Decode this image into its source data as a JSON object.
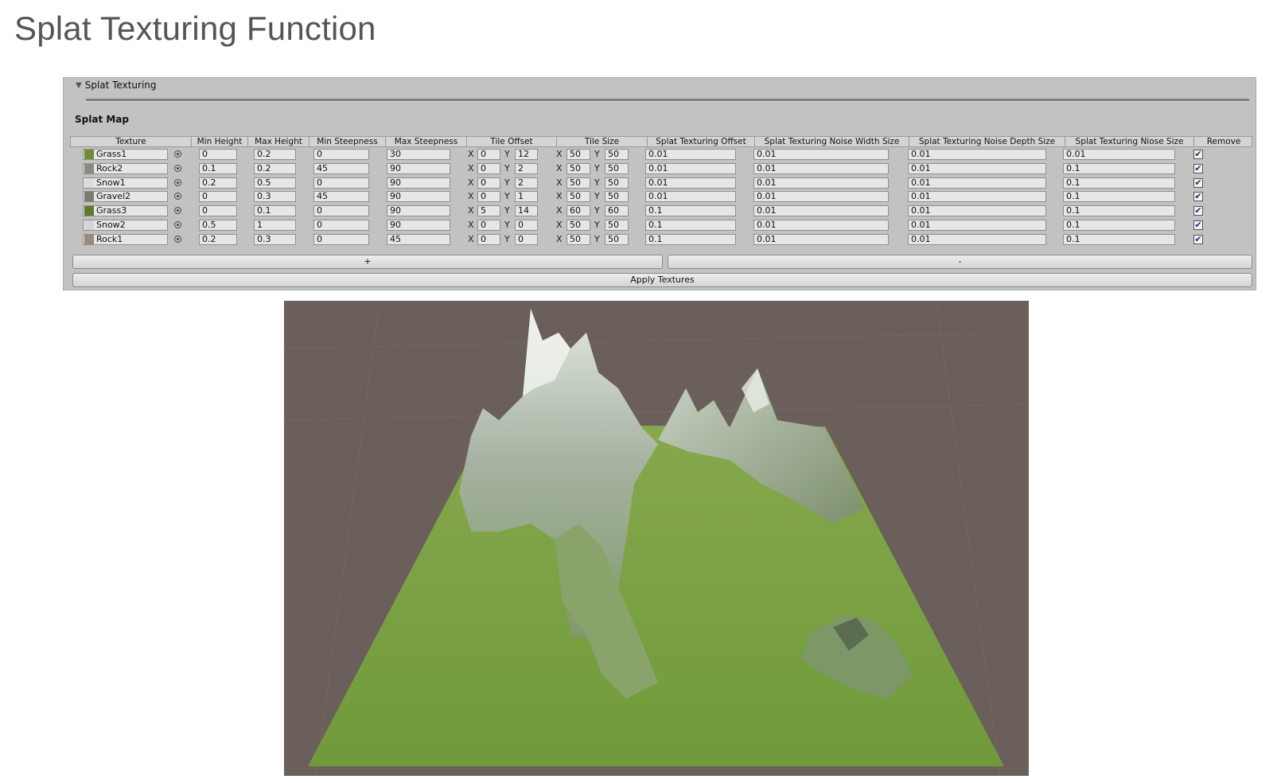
{
  "page_title": "Splat Texturing Function",
  "panel": {
    "foldout_label": "Splat Texturing",
    "section_label": "Splat Map",
    "columns": {
      "texture": "Texture",
      "min_height": "Min Height",
      "max_height": "Max Height",
      "min_steepness": "Min Steepness",
      "max_steepness": "Max Steepness",
      "tile_offset": "Tile Offset",
      "tile_size": "Tile Size",
      "splat_offset": "Splat Texturing Offset",
      "noise_width": "Splat Texturing Noise Width Size",
      "noise_depth": "Splat Texturing Noise Depth Size",
      "noise_size": "Splat Texturing Niose Size",
      "remove": "Remove"
    },
    "axis_labels": {
      "x": "X",
      "y": "Y"
    },
    "rows": [
      {
        "texture": "Grass1",
        "swatch": "#6f8b3a",
        "min_height": "0",
        "max_height": "0.2",
        "min_steepness": "0",
        "max_steepness": "30",
        "offset_x": "0",
        "offset_y": "12",
        "size_x": "50",
        "size_y": "50",
        "splat_offset": "0.01",
        "noise_width": "0.01",
        "noise_depth": "0.01",
        "noise_size": "0.01",
        "checked": "✔"
      },
      {
        "texture": "Rock2",
        "swatch": "#8a8a80",
        "min_height": "0.1",
        "max_height": "0.2",
        "min_steepness": "45",
        "max_steepness": "90",
        "offset_x": "0",
        "offset_y": "2",
        "size_x": "50",
        "size_y": "50",
        "splat_offset": "0.01",
        "noise_width": "0.01",
        "noise_depth": "0.01",
        "noise_size": "0.1",
        "checked": "✔"
      },
      {
        "texture": "Snow1",
        "swatch": "#dcdcdc",
        "min_height": "0.2",
        "max_height": "0.5",
        "min_steepness": "0",
        "max_steepness": "90",
        "offset_x": "0",
        "offset_y": "2",
        "size_x": "50",
        "size_y": "50",
        "splat_offset": "0.01",
        "noise_width": "0.01",
        "noise_depth": "0.01",
        "noise_size": "0.1",
        "checked": "✔"
      },
      {
        "texture": "Gravel2",
        "swatch": "#7c7c6c",
        "min_height": "0",
        "max_height": "0.3",
        "min_steepness": "45",
        "max_steepness": "90",
        "offset_x": "0",
        "offset_y": "1",
        "size_x": "50",
        "size_y": "50",
        "splat_offset": "0.01",
        "noise_width": "0.01",
        "noise_depth": "0.01",
        "noise_size": "0.1",
        "checked": "✔"
      },
      {
        "texture": "Grass3",
        "swatch": "#5f7a2c",
        "min_height": "0",
        "max_height": "0.1",
        "min_steepness": "0",
        "max_steepness": "90",
        "offset_x": "5",
        "offset_y": "14",
        "size_x": "60",
        "size_y": "60",
        "splat_offset": "0.1",
        "noise_width": "0.01",
        "noise_depth": "0.01",
        "noise_size": "0.1",
        "checked": "✔"
      },
      {
        "texture": "Snow2",
        "swatch": "#d6d6d6",
        "min_height": "0.5",
        "max_height": "1",
        "min_steepness": "0",
        "max_steepness": "90",
        "offset_x": "0",
        "offset_y": "0",
        "size_x": "50",
        "size_y": "50",
        "splat_offset": "0.1",
        "noise_width": "0.01",
        "noise_depth": "0.01",
        "noise_size": "0.1",
        "checked": "✔"
      },
      {
        "texture": "Rock1",
        "swatch": "#9a8a78",
        "min_height": "0.2",
        "max_height": "0.3",
        "min_steepness": "0",
        "max_steepness": "45",
        "offset_x": "0",
        "offset_y": "0",
        "size_x": "50",
        "size_y": "50",
        "splat_offset": "0.1",
        "noise_width": "0.01",
        "noise_depth": "0.01",
        "noise_size": "0.1",
        "checked": "✔"
      }
    ],
    "add_button": "+",
    "remove_button": "-",
    "apply_button": "Apply Textures"
  },
  "colors": {
    "panel_bg": "#c2c2c2",
    "scene_bg": "#6a5f5a",
    "grass": "#7ea444",
    "rock": "#9aa79a",
    "snow": "#d8e0d8"
  }
}
